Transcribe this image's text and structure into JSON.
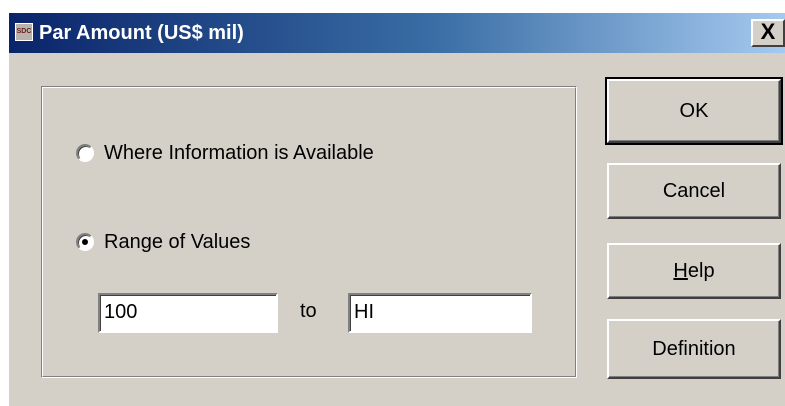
{
  "window": {
    "title": "Par Amount (US$ mil)",
    "app_icon": "app-icon",
    "app_icon_text": "SDC",
    "close_label": "X"
  },
  "options": [
    {
      "label": "Where Information is Available",
      "checked": false
    },
    {
      "label": "Range of Values",
      "checked": true
    }
  ],
  "range": {
    "from_value": "100",
    "to_label": "to",
    "to_value": "HI"
  },
  "buttons": {
    "ok": "OK",
    "cancel": "Cancel",
    "help_mnemonic": "H",
    "help_rest": "elp",
    "definition": "Definition"
  },
  "colors": {
    "title_gradient_start": "#0a246a",
    "title_gradient_end": "#a6caf0",
    "face": "#d4d0c8"
  }
}
